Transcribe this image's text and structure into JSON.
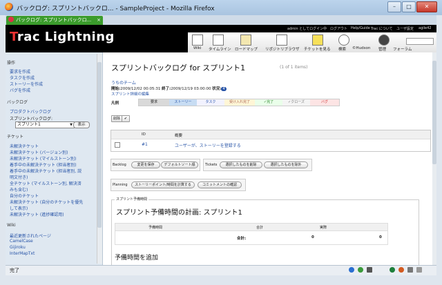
{
  "window": {
    "title": "バックログ: スプリントバックロ... - SampleProject - Mozilla Firefox",
    "minimize": "–",
    "maximize": "□",
    "close": "✕"
  },
  "tab": {
    "label": "バックログ: スプリントバックロ...",
    "close": "×"
  },
  "header": {
    "logo_first": "T",
    "logo_rest": "rac Lightning",
    "user_links": [
      "admin としてログイン中",
      "ログアウト",
      "Help/Guide",
      "Trac について",
      "ユーザ設定",
      "agile42"
    ],
    "menu": [
      "Wiki",
      "タイムライン",
      "ロードマップ",
      "リポジトリブラウザ",
      "チケットを見る",
      "検索",
      "©Hudson",
      "管理",
      "フォーラム"
    ]
  },
  "sidebar": {
    "sec_ops": "操作",
    "ops": [
      "要求を作成",
      "タスクを作成",
      "ストーリーを作成",
      "バグを作成"
    ],
    "sec_backlog": "バックログ",
    "backlog_link": "プロダクトバックログ",
    "sprint_label": "スプリントバックログ:",
    "sprint_value": "スプリント1",
    "show_button": "表示",
    "sec_ticket": "チケット",
    "tickets": [
      "未解決チケット",
      "未解決チケット (バージョン別)",
      "未解決チケット (マイルストーン別)",
      "着手中の未解決チケット (担当者別)",
      "着手中の未解決チケット (担当者別, 説",
      "明文付き)",
      "全チケット (マイルストーン別, 解決済",
      "みも含む)",
      "自分のチケット",
      "未解決チケット (自分のチケットを優先",
      "して表示)",
      "未解決チケット (進捗確認用)"
    ],
    "sec_wiki": "Wiki",
    "wiki": [
      "最近更新されたページ",
      "CamelCase",
      "Gijiroku",
      "InterMapTxt"
    ]
  },
  "main": {
    "title": "スプリントバックログ for スプリント1",
    "count": "(1 of 1 items)",
    "team": "うちのチーム",
    "start_label": "開始:",
    "start": "2009/12/02 00:05:31",
    "end_label": "終了:",
    "end": "2009/12/19 03:00:00",
    "status_label": "状況:",
    "status_value": "4",
    "edit_link": "スプリント詳細の編集",
    "legend_label": "凡例",
    "legend": [
      "要求",
      "ストーリー",
      "タスク",
      "受け入れ完了",
      "✓完了",
      "✓クローズ",
      "バグ"
    ],
    "delete_btn": "削除",
    "check_btn": "✔",
    "table_headers": [
      "ID",
      "概要"
    ],
    "rows": [
      {
        "id": "#1",
        "summary": "ユーザーが、ストーリーを登録する"
      }
    ],
    "backlog_label": "Backlog",
    "save_btn": "変更を保存",
    "default_sort_btn": "デフォルトソート順",
    "tickets_label": "Tickets",
    "remove_btn": "選択したものを削除",
    "sort_btn": "選択したものを除外",
    "planning_label": "Planning",
    "calc_btn": "ストーリーポイント/時間を計算する",
    "commit_btn": "コミットメントの確認",
    "fieldset_legend": "スプリント予備時間",
    "plan_title": "スプリント予備時間の計画: スプリント1",
    "plan_headers": [
      "予備時間",
      "合計",
      "実際"
    ],
    "plan_row_label": "合計:",
    "plan_total": "0",
    "plan_actual": "0",
    "add_title": "予備時間を追加"
  },
  "status": {
    "text": "完了"
  },
  "colors": {
    "legend_req": "#d9d9d9",
    "legend_story": "#c7dcf3",
    "legend_task": "#f2f2ff",
    "legend_accepted": "#fff6d6",
    "legend_done": "#eaffea",
    "legend_closed": "#f4f4f4",
    "legend_bug": "#fde4e4"
  }
}
